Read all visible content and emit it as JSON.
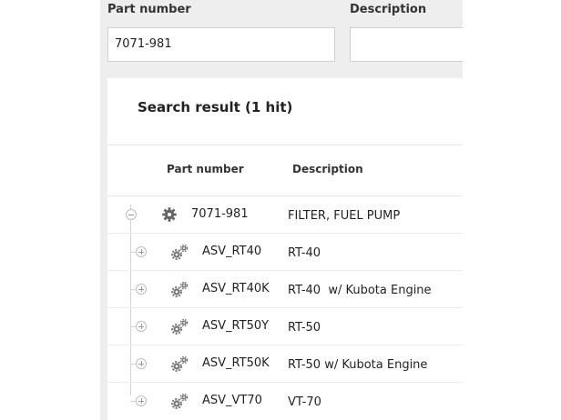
{
  "search_form": {
    "part_number_label": "Part number",
    "part_number_value": "7071-981",
    "description_label": "Description",
    "description_value": ""
  },
  "results": {
    "title": "Search result (1 hit)",
    "columns": {
      "part_number": "Part number",
      "description": "Description"
    },
    "parent": {
      "part_number": "7071-981",
      "description": "FILTER, FUEL PUMP",
      "icon": "gear-icon",
      "expanded": true
    },
    "children": [
      {
        "part_number": "ASV_RT40",
        "description": "RT-40",
        "icon": "gears-icon"
      },
      {
        "part_number": "ASV_RT40K",
        "description": "RT-40  w/ Kubota Engine",
        "icon": "gears-icon"
      },
      {
        "part_number": "ASV_RT50Y",
        "description": "RT-50",
        "icon": "gears-icon"
      },
      {
        "part_number": "ASV_RT50K",
        "description": "RT-50 w/ Kubota Engine",
        "icon": "gears-icon"
      },
      {
        "part_number": "ASV_VT70",
        "description": "VT-70",
        "icon": "gears-icon"
      }
    ]
  }
}
